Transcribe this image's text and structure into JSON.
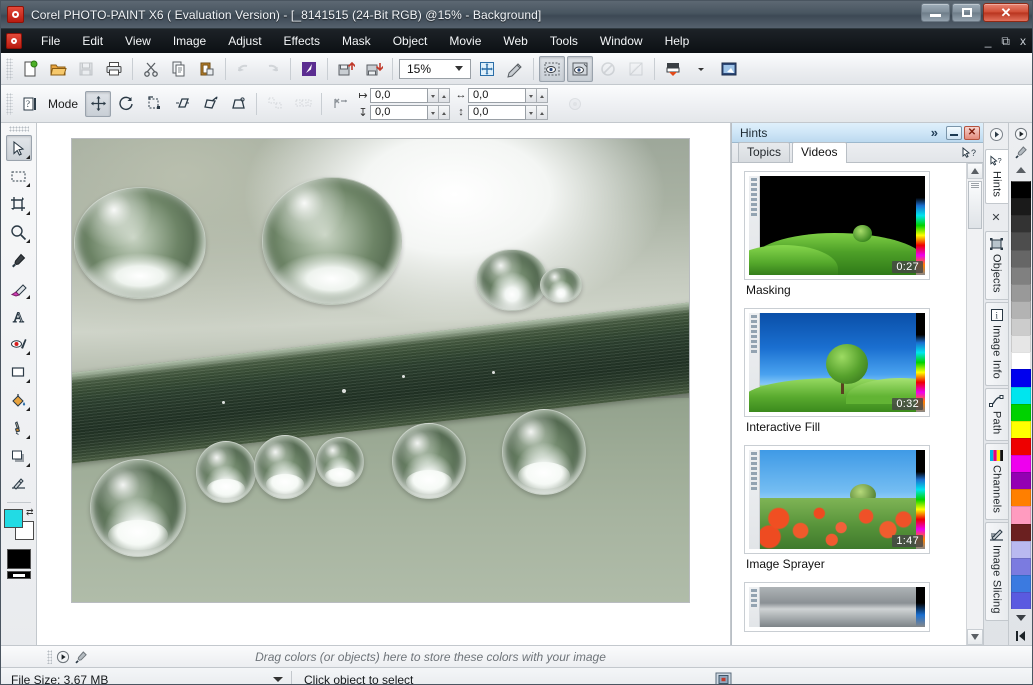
{
  "window": {
    "title": "Corel PHOTO-PAINT X6 ( Evaluation Version) - [_8141515 (24-Bit RGB) @15% - Background]",
    "app_icon": "corel-photopaint-icon",
    "buttons": {
      "minimize": "minimize",
      "maximize": "maximize",
      "close": "close"
    }
  },
  "menubar": {
    "icon": "document-control-icon",
    "items": [
      {
        "label": "File",
        "accel": "F"
      },
      {
        "label": "Edit",
        "accel": "E"
      },
      {
        "label": "View",
        "accel": "V"
      },
      {
        "label": "Image",
        "accel": "I"
      },
      {
        "label": "Adjust",
        "accel": "A"
      },
      {
        "label": "Effects",
        "accel": "c"
      },
      {
        "label": "Mask",
        "accel": "k"
      },
      {
        "label": "Object",
        "accel": "O"
      },
      {
        "label": "Movie",
        "accel": "M"
      },
      {
        "label": "Web",
        "accel": "W"
      },
      {
        "label": "Tools",
        "accel": "T"
      },
      {
        "label": "Window",
        "accel": "W"
      },
      {
        "label": "Help",
        "accel": "H"
      }
    ],
    "doc_buttons": {
      "minimize": "_",
      "restore": "restore",
      "close": "x"
    }
  },
  "toolbar": {
    "buttons": [
      {
        "name": "new-button",
        "tip": "New"
      },
      {
        "name": "open-button",
        "tip": "Open"
      },
      {
        "name": "save-button",
        "tip": "Save",
        "disabled": true
      },
      {
        "name": "print-button",
        "tip": "Print"
      },
      {
        "name": "cut-button",
        "tip": "Cut"
      },
      {
        "name": "copy-button",
        "tip": "Copy"
      },
      {
        "name": "paste-button",
        "tip": "Paste"
      },
      {
        "name": "undo-button",
        "tip": "Undo",
        "disabled": true
      },
      {
        "name": "redo-button",
        "tip": "Redo",
        "disabled": true
      },
      {
        "name": "corel-connect-button",
        "tip": "Corel CONNECT"
      },
      {
        "name": "import-button",
        "tip": "Import"
      },
      {
        "name": "export-button",
        "tip": "Export"
      }
    ],
    "zoom": {
      "value": "15%",
      "name": "zoom-level-combo"
    },
    "after_zoom": [
      {
        "name": "full-screen-preview-button",
        "tip": "Full-screen preview"
      },
      {
        "name": "image-adjustment-lab-button",
        "tip": "Image Adjustment Lab"
      },
      {
        "name": "mask-marquee-button",
        "tip": "Mask marquee visible",
        "pressed": true
      },
      {
        "name": "mask-overlay-button",
        "tip": "Mask overlay",
        "pressed": true
      },
      {
        "name": "clear-mask-button",
        "tip": "Clear mask",
        "disabled": true
      },
      {
        "name": "invert-mask-button",
        "tip": "Invert mask",
        "disabled": true
      },
      {
        "name": "publish-to-pdf-button",
        "tip": "Publish to PDF"
      },
      {
        "name": "application-launcher-button",
        "tip": "Application launcher"
      }
    ]
  },
  "propertybar": {
    "mode_label": "Mode",
    "modes": [
      {
        "name": "object-position-mode",
        "selected": true
      },
      {
        "name": "object-rotate-mode",
        "selected": false
      },
      {
        "name": "object-scale-mode",
        "selected": false
      },
      {
        "name": "object-skew-mode",
        "selected": false
      },
      {
        "name": "object-distort-mode",
        "selected": false
      },
      {
        "name": "object-perspective-mode",
        "selected": false
      }
    ],
    "align_buttons": [
      {
        "name": "align-objects-button",
        "disabled": true
      },
      {
        "name": "distribute-objects-button",
        "disabled": true
      },
      {
        "name": "anti-alias-button",
        "disabled": false
      }
    ],
    "fields": [
      {
        "name": "position-x-field",
        "value": "0,0"
      },
      {
        "name": "position-y-field",
        "value": "0,0"
      },
      {
        "name": "size-width-field",
        "value": "0,0"
      },
      {
        "name": "size-height-field",
        "value": "0,0"
      }
    ],
    "end_button": {
      "name": "object-properties-button",
      "disabled": true
    }
  },
  "toolbox": {
    "tools": [
      {
        "name": "pick-tool",
        "label": "Pick",
        "active": true,
        "flyout": true
      },
      {
        "name": "mask-rectangle-tool",
        "label": "Rectangle Mask",
        "active": false,
        "flyout": true
      },
      {
        "name": "crop-tool",
        "label": "Crop",
        "active": false,
        "flyout": true
      },
      {
        "name": "zoom-tool",
        "label": "Zoom",
        "active": false,
        "flyout": true
      },
      {
        "name": "eyedropper-tool",
        "label": "Color Eyedropper",
        "active": false,
        "flyout": false
      },
      {
        "name": "eraser-tool",
        "label": "Eraser",
        "active": false,
        "flyout": true
      },
      {
        "name": "text-tool",
        "label": "Text",
        "active": false,
        "flyout": false
      },
      {
        "name": "red-eye-removal-tool",
        "label": "Red Eye Removal",
        "active": false,
        "flyout": true
      },
      {
        "name": "rectangle-shape-tool",
        "label": "Rectangle",
        "active": false,
        "flyout": true
      },
      {
        "name": "fill-tool",
        "label": "Fill",
        "active": false,
        "flyout": true
      },
      {
        "name": "smear-tool",
        "label": "Smear",
        "active": false,
        "flyout": true
      },
      {
        "name": "drop-shadow-tool",
        "label": "Drop Shadow",
        "active": false,
        "flyout": true
      },
      {
        "name": "interactive-fill-tool",
        "label": "Interactive Fill",
        "active": false,
        "flyout": false
      }
    ],
    "colors": {
      "foreground": "#22dbe4",
      "background": "#ffffff",
      "fill": "#000000",
      "outline": "#000000"
    }
  },
  "canvas": {
    "name": "image-canvas",
    "document": "_8141515",
    "zoom": "15%",
    "subject": "macro photo of water droplets on a blade of grass"
  },
  "hints_docker": {
    "title": "Hints",
    "chevron": "»",
    "buttons": {
      "minimize": "minimize-docker",
      "close": "close-docker"
    },
    "tabs": [
      {
        "label": "Topics",
        "selected": false
      },
      {
        "label": "Videos",
        "selected": true
      }
    ],
    "help_icon": "pointer-question-icon",
    "videos": [
      {
        "label": "Masking",
        "duration": "0:27",
        "scene": "night"
      },
      {
        "label": "Interactive Fill",
        "duration": "0:32",
        "scene": "day"
      },
      {
        "label": "Image Sprayer",
        "duration": "1:47",
        "scene": "flowers"
      },
      {
        "label": "",
        "duration": "",
        "scene": "stone"
      }
    ],
    "scrollbar": {
      "name": "docker-scrollbar",
      "up": "▲",
      "down": "▼"
    }
  },
  "dock_rail": {
    "items": [
      {
        "label": "Hints",
        "icon": "pointer-question-icon",
        "selected": true
      },
      {
        "label": "Objects",
        "icon": "objects-icon",
        "selected": false
      },
      {
        "label": "Image Info",
        "icon": "image-info-icon",
        "selected": false
      },
      {
        "label": "Path",
        "icon": "path-icon",
        "selected": false
      },
      {
        "label": "Channels",
        "icon": "channels-icon",
        "selected": false
      },
      {
        "label": "Image Slicing",
        "icon": "image-slicing-icon",
        "selected": false
      }
    ],
    "close_label": "✕"
  },
  "palette": {
    "name": "color-palette",
    "top_buttons": [
      {
        "name": "palette-play-icon"
      },
      {
        "name": "palette-eyedropper-icon"
      },
      {
        "name": "palette-scroll-up-icon"
      }
    ],
    "swatches": [
      "#000000",
      "#1a1a1a",
      "#333333",
      "#4d4d4d",
      "#666666",
      "#808080",
      "#999999",
      "#b3b3b3",
      "#cccccc",
      "#e6e6e6",
      "#ffffff",
      "#0000ee",
      "#00e5ee",
      "#00d200",
      "#ffff00",
      "#ee0000",
      "#ee00ee",
      "#9400b3",
      "#ff7f00",
      "#ff9bbf",
      "#6b2020",
      "#b9b9f0",
      "#7b7be0",
      "#3b7ae0",
      "#5a5ae0"
    ],
    "bottom_buttons": [
      {
        "name": "palette-scroll-down-icon"
      },
      {
        "name": "palette-home-icon"
      }
    ]
  },
  "colorstrip": {
    "play_icon": "play-icon",
    "eyedropper_icon": "eyedropper-icon",
    "message": "Drag colors (or objects) here to store these colors with your image"
  },
  "statusbar": {
    "file_size_label": "File Size: 3.67 MB",
    "hint": "Click object to select",
    "mode_icon": "color-proof-icon"
  }
}
